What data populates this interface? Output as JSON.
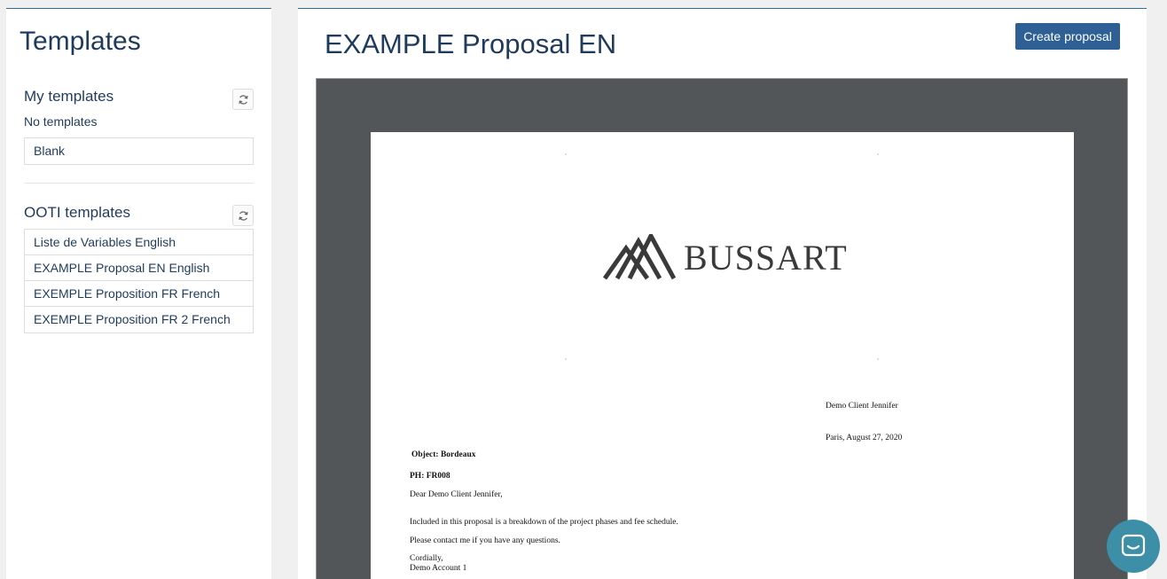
{
  "sidebar": {
    "title": "Templates",
    "my_templates": {
      "title": "My templates",
      "empty_text": "No templates",
      "items": [
        "Blank"
      ]
    },
    "ooti_templates": {
      "title": "OOTI templates",
      "items": [
        "Liste de Variables English",
        "EXAMPLE Proposal EN English",
        "EXEMPLE Proposition FR French",
        "EXEMPLE Proposition FR 2 French"
      ]
    }
  },
  "main": {
    "title": "EXAMPLE Proposal EN",
    "create_button": "Create proposal"
  },
  "document": {
    "logo_text": "BUSSART",
    "recipient": "Demo Client Jennifer",
    "date_line": "Paris, August 27, 2020",
    "object": "Object: Bordeaux",
    "ph": "PH: FR008",
    "greeting": "Dear Demo Client Jennifer,",
    "body1": "Included in this proposal is a breakdown of the project phases and fee schedule.",
    "body2": "Please contact me if you have any questions.",
    "closing": "Cordially,",
    "signature": "Demo Account 1"
  },
  "icons": {
    "refresh": "refresh-icon",
    "chat": "chat-icon"
  },
  "colors": {
    "accent": "#2e5f95",
    "heading": "#1f3b5c",
    "viewer_bg": "#525659",
    "chat": "#3c8fa6"
  }
}
